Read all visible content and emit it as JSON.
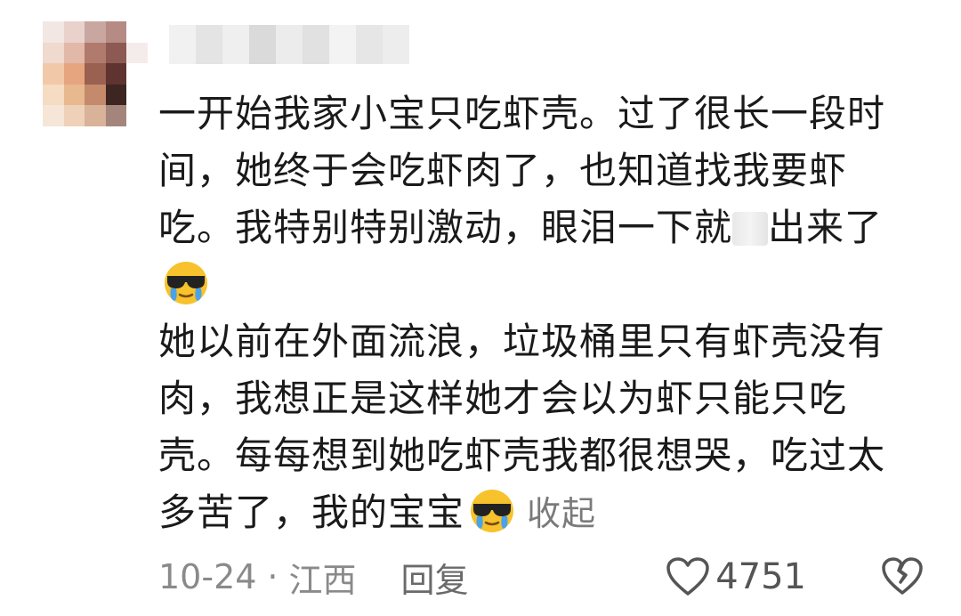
{
  "comment": {
    "paragraphs": {
      "p1_line1": "一开始我家小宝只吃虾壳。过了很长一段时",
      "p1_line2": "间，她终于会吃虾肉了，也知道找我要虾",
      "p1_line3a": "吃。我特别特别激动，眼泪一下就",
      "p1_line3b": "出来了",
      "p2_line1": "她以前在外面流浪，垃圾桶里只有虾壳没有",
      "p2_line2": "肉，我想正是这样她才会以为虾只能只吃",
      "p2_line3": "壳。每每想到她吃虾壳我都很想哭，吃过太",
      "p2_line4": "多苦了，我的宝宝"
    },
    "collapse_label": "收起"
  },
  "meta": {
    "date": "10-24",
    "separator": "·",
    "location": "江西",
    "reply_label": "回复",
    "like_count": "4751"
  },
  "icons": {
    "emoji": "sunglasses-crying-face",
    "like": "heart-outline-icon",
    "dislike": "broken-heart-icon"
  },
  "colors": {
    "text": "#1a1a1a",
    "muted": "#8a8a8a",
    "emoji_face": "#f7c22b",
    "tear": "#4aa3e8"
  }
}
